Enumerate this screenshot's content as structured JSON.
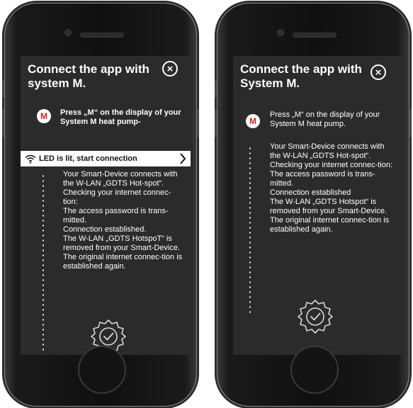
{
  "left_phone": {
    "title": "Connect the app with system M.",
    "close_symbol": "×",
    "step_badge": "M",
    "step_text": "Press „M“ on the display of your System M heat pump-",
    "connect_bar_label": "LED is lit, start connection",
    "status_lines": [
      "Your Smart-Device connects with the W-LAN „GDTS Hot-spot“.",
      "Checking your internet connec-tion:",
      "The access password is trans-mitted.",
      "Connection established.",
      "The W-LAN „GDTS HotspoT“ is removed from your Smart-Device.",
      "The original internet connec-tion is established again."
    ]
  },
  "right_phone": {
    "title": "Connect the app with System M.",
    "close_symbol": "×",
    "step_badge": "M",
    "step_text": "Press „M“ on the display of your System M heat pump.",
    "status_lines": [
      "Your Smart-Device connects with the W-LAN „GDTS Hot-spot“.",
      "Checking your internet connec-tion:",
      "The access password is trans-mitted.",
      "Connection established",
      "The W-LAN „GDTS Hotspot“ is removed from your Smart-Device.",
      "The original internet connec-tion is established again."
    ]
  },
  "colors": {
    "screen_bg": "#2b2b2b",
    "brand_red": "#d21f26",
    "text": "#ffffff"
  },
  "icons": {
    "wifi": "wifi-icon",
    "chevron": "chevron-right-icon",
    "close": "close-icon",
    "success": "check-seal-icon"
  }
}
